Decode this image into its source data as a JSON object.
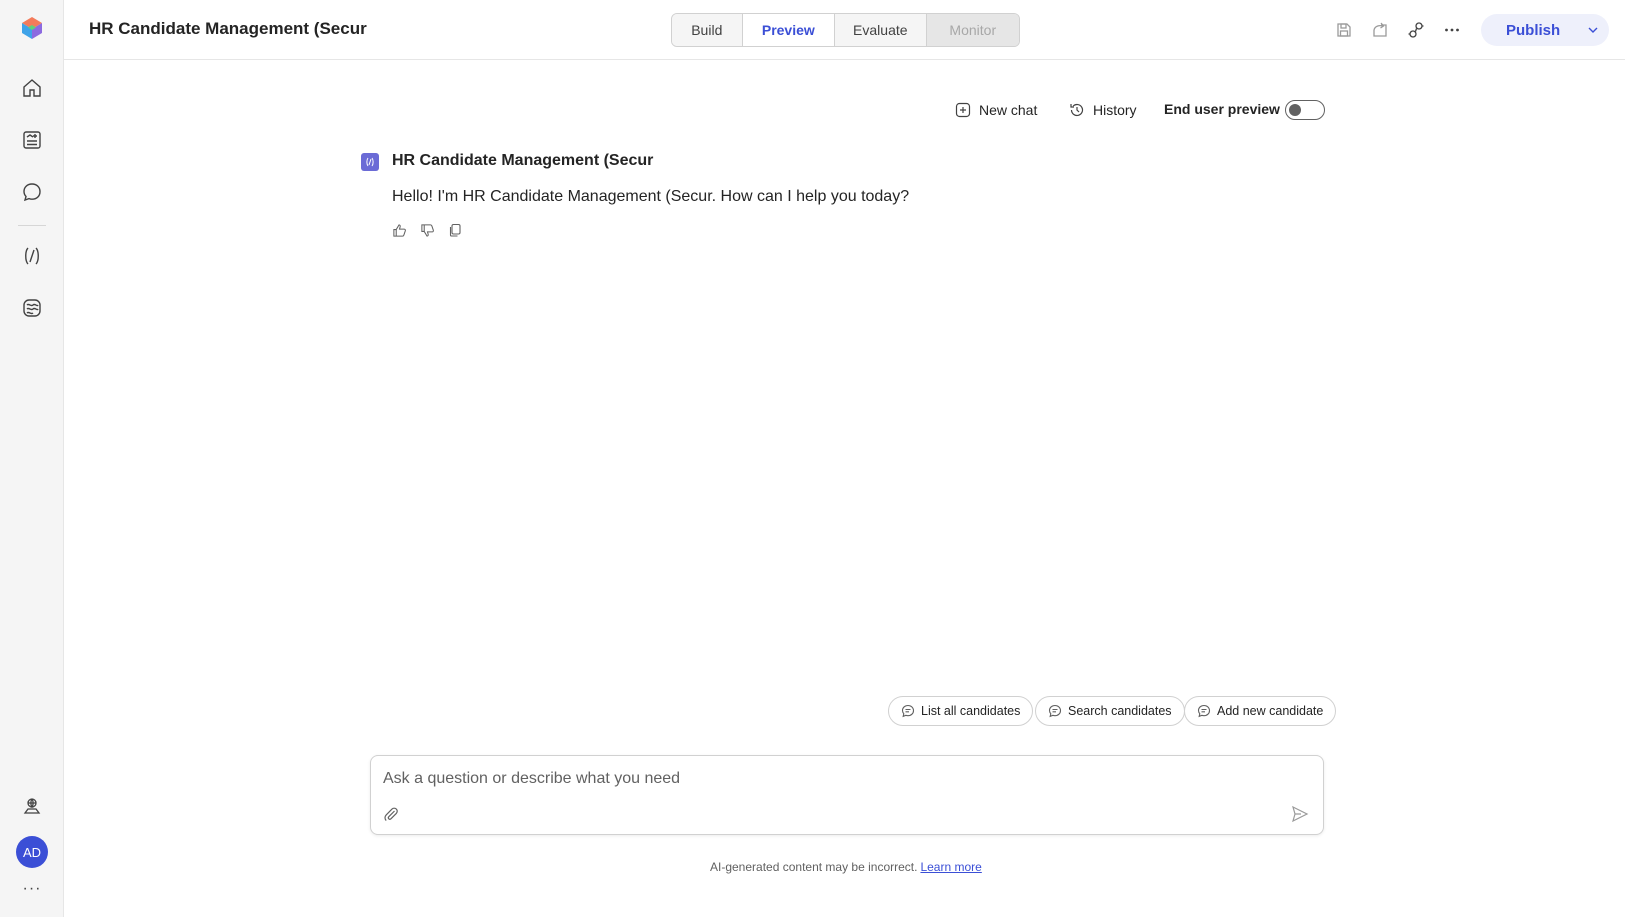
{
  "app": {
    "title": "HR Candidate Management (Secur",
    "colors": {
      "accent": "#3b4fd6",
      "rail_bg": "#f5f5f5",
      "border": "#d1d1d1"
    }
  },
  "rail": {
    "logo_icon": "copilot-studio-logo-icon",
    "items": [
      {
        "icon": "home-icon",
        "label": "Home"
      },
      {
        "icon": "create-icon",
        "label": "Create"
      },
      {
        "icon": "agents-icon",
        "label": "Agents"
      },
      {
        "icon": "flows-icon",
        "label": "Flows"
      },
      {
        "icon": "tools-icon",
        "label": "Tools"
      }
    ],
    "bottom": [
      {
        "icon": "environment-icon"
      }
    ],
    "avatar_initials": "AD",
    "more": "···"
  },
  "tabs": [
    {
      "label": "Build",
      "state": "normal"
    },
    {
      "label": "Preview",
      "state": "selected"
    },
    {
      "label": "Evaluate",
      "state": "normal"
    },
    {
      "label": "Monitor",
      "state": "disabled"
    }
  ],
  "toolbar": {
    "icons": [
      "save-icon",
      "share-icon",
      "connect-icon",
      "more-icon"
    ],
    "publish_label": "Publish"
  },
  "chat_toolbar": {
    "new_chat_label": "New chat",
    "history_label": "History",
    "end_user_preview_label": "End user preview",
    "end_user_preview_on": false
  },
  "conversation": {
    "bot_name": "HR Candidate Management (Secur",
    "bot_message": "Hello! I'm HR Candidate Management (Secur. How can I help you today?"
  },
  "suggestions": [
    {
      "label": "List all candidates"
    },
    {
      "label": "Search candidates"
    },
    {
      "label": "Add new candidate"
    }
  ],
  "composer": {
    "placeholder": "Ask a question or describe what you need",
    "value": ""
  },
  "footer": {
    "disclaimer": "AI-generated content may be incorrect.",
    "learn_more": "Learn more"
  }
}
